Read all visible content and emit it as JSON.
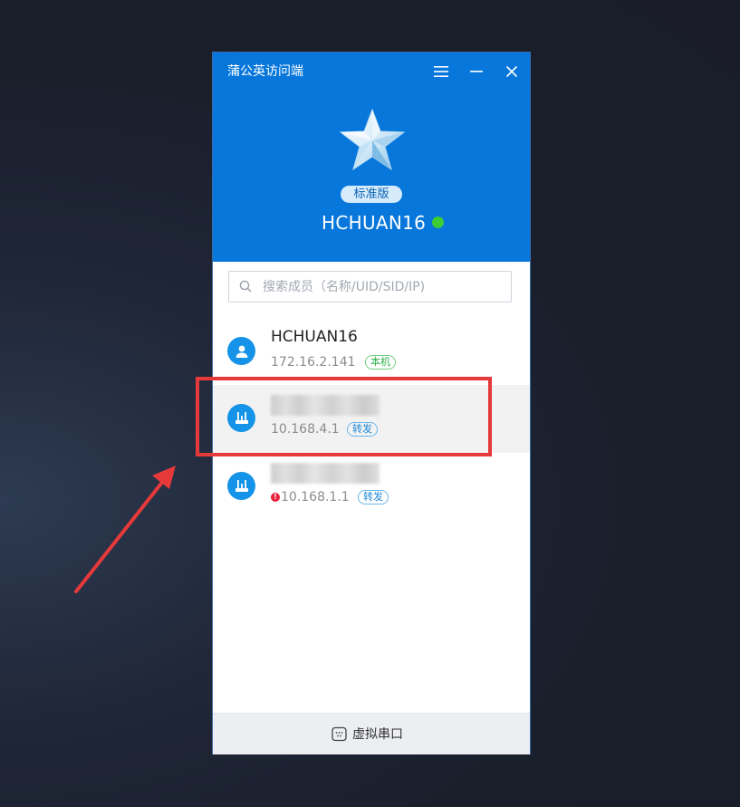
{
  "window": {
    "title": "蒲公英访问端",
    "menu_icon": "hamburger-menu-icon",
    "minimize_icon": "minimize-icon",
    "close_icon": "close-icon"
  },
  "profile": {
    "avatar_icon": "star-icon",
    "edition": "标准版",
    "username": "HCHUAN16",
    "status": "online",
    "status_color": "#3fcd35"
  },
  "search": {
    "placeholder": "搜索成员（名称/UID/SID/IP)",
    "icon": "search-icon"
  },
  "members": [
    {
      "name": "HCHUAN16",
      "ip": "172.16.2.141",
      "tag": "本机",
      "icon": "user-icon",
      "selected": false,
      "warning": false
    },
    {
      "name": "",
      "ip": "10.168.4.1",
      "tag": "转发",
      "icon": "router-icon",
      "selected": true,
      "warning": false
    },
    {
      "name": "",
      "ip": "10.168.1.1",
      "tag": "转发",
      "icon": "router-icon",
      "selected": false,
      "warning": true
    }
  ],
  "footer": {
    "label": "虚拟串口",
    "icon": "serial-port-icon"
  },
  "colors": {
    "accent": "#0777db",
    "highlight": "#e5393a",
    "warning": "#e9223c"
  }
}
